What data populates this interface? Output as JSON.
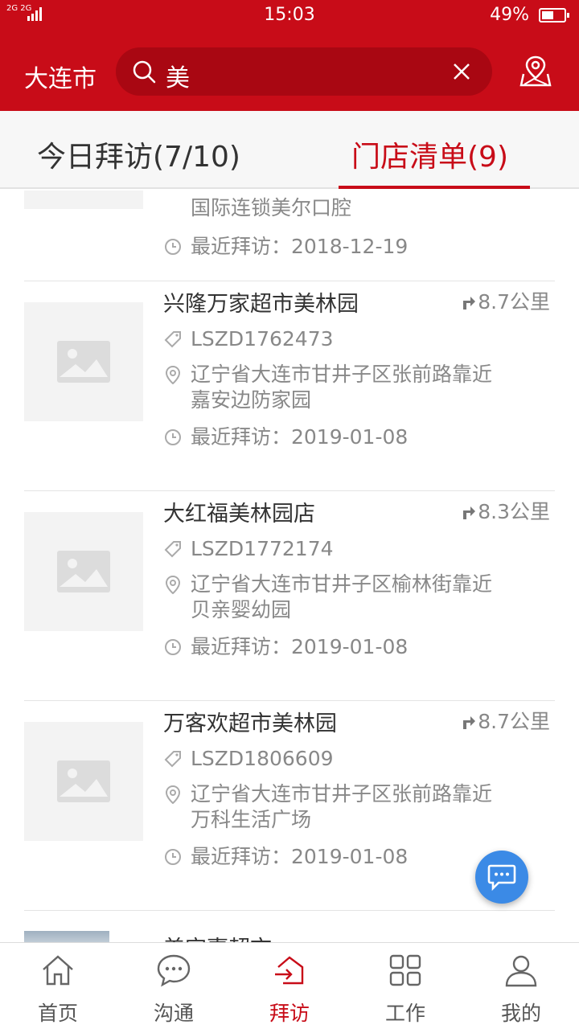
{
  "status_bar": {
    "network": "2G 2G",
    "time": "15:03",
    "battery": "49%",
    "battery_level": 0.49
  },
  "header": {
    "city": "大连市",
    "search_query": "美",
    "icons": [
      "search-icon",
      "clear-icon",
      "map-location-icon"
    ]
  },
  "tabs": [
    {
      "label": "今日拜访(7/10)",
      "active": false
    },
    {
      "label": "门店清单(9)",
      "active": true
    }
  ],
  "partial_store": {
    "address_line2": "国际连锁美尔口腔",
    "last_visit": "最近拜访：2018-12-19"
  },
  "stores": [
    {
      "name": "兴隆万家超市美林园",
      "distance": "8.7公里",
      "code": "LSZD1762473",
      "address_line1": "辽宁省大连市甘井子区张前路靠近",
      "address_line2": "嘉安边防家园",
      "last_visit": "最近拜访：2019-01-08"
    },
    {
      "name": "大红福美林园店",
      "distance": "8.3公里",
      "code": "LSZD1772174",
      "address_line1": "辽宁省大连市甘井子区榆林街靠近",
      "address_line2": "贝亲婴幼园",
      "last_visit": "最近拜访：2019-01-08"
    },
    {
      "name": "万客欢超市美林园",
      "distance": "8.7公里",
      "code": "LSZD1806609",
      "address_line1": "辽宁省大连市甘井子区张前路靠近",
      "address_line2": "万科生活广场",
      "last_visit": "最近拜访：2019-01-08"
    }
  ],
  "peek_store": {
    "name": "美宜嘉超市"
  },
  "colors": {
    "brand": "#c80c18",
    "fab": "#3b8ae6"
  },
  "tabbar": [
    {
      "label": "首页",
      "icon": "home-icon",
      "active": false
    },
    {
      "label": "沟通",
      "icon": "chat-icon",
      "active": false
    },
    {
      "label": "拜访",
      "icon": "visit-icon",
      "active": true
    },
    {
      "label": "工作",
      "icon": "grid-icon",
      "active": false
    },
    {
      "label": "我的",
      "icon": "person-icon",
      "active": false
    }
  ]
}
